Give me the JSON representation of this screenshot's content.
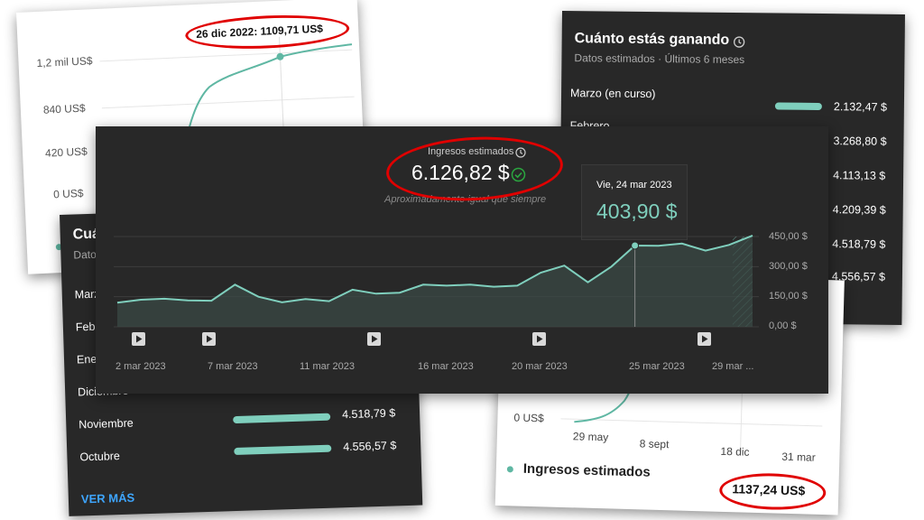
{
  "colors": {
    "accent": "#7fcfbd",
    "dark_bg": "#282828",
    "annotation": "#e00000"
  },
  "card_tl": {
    "y_ticks": [
      "1,2 mil US$",
      "840 US$",
      "420 US$",
      "0 US$"
    ],
    "callout": "26 dic 2022: 1109,71 US$"
  },
  "card_tr": {
    "title": "Cuánto estás ganando",
    "subtitle": "Datos estimados · Últimos 6 meses",
    "rows": [
      {
        "label": "Marzo (en curso)",
        "value": "2.132,47 $",
        "fraction": 0.47
      },
      {
        "label": "Febrero",
        "value": "3.268,80 $",
        "fraction": 0.72
      },
      {
        "label": "",
        "value": "4.113,13 $",
        "fraction": 0.9
      },
      {
        "label": "",
        "value": "4.209,39 $",
        "fraction": 0.92
      },
      {
        "label": "",
        "value": "4.518,79 $",
        "fraction": 0.99
      },
      {
        "label": "",
        "value": "4.556,57 $",
        "fraction": 1.0
      }
    ],
    "icon": "clock-icon"
  },
  "card_bl": {
    "title_partial": "Cuá",
    "subtitle_partial": "Dato",
    "rows_partial": [
      "Marz",
      "Febr",
      "Ener",
      "Diciembre"
    ],
    "rows": [
      {
        "label": "Noviembre",
        "value": "4.518,79 $",
        "fraction": 0.99
      },
      {
        "label": "Octubre",
        "value": "4.556,57 $",
        "fraction": 1.0
      }
    ],
    "link": "VER MÁS"
  },
  "card_br": {
    "y_ticks": [
      "0 US$"
    ],
    "x_ticks": [
      "29 may",
      "8 sept",
      "18 dic",
      "31 mar"
    ],
    "legend": "Ingresos estimados",
    "total": "1137,24 US$"
  },
  "main": {
    "heading": "Ingresos estimados",
    "total": "6.126,82 $",
    "note": "Aproximadamente igual que siempre",
    "tooltip": {
      "date": "Vie, 24 mar 2023",
      "value": "403,90 $"
    },
    "y_ticks": [
      "450,00 $",
      "300,00 $",
      "150,00 $",
      "0,00 $"
    ],
    "x_ticks": [
      "2 mar 2023",
      "7 mar 2023",
      "11 mar 2023",
      "16 mar 2023",
      "20 mar 2023",
      "25 mar 2023",
      "29 mar ..."
    ]
  },
  "chart_data": {
    "type": "area",
    "x": [
      "1 mar",
      "2 mar",
      "3 mar",
      "4 mar",
      "5 mar",
      "6 mar",
      "7 mar",
      "8 mar",
      "9 mar",
      "10 mar",
      "11 mar",
      "12 mar",
      "13 mar",
      "14 mar",
      "15 mar",
      "16 mar",
      "17 mar",
      "18 mar",
      "19 mar",
      "20 mar",
      "21 mar",
      "22 mar",
      "23 mar",
      "24 mar",
      "25 mar",
      "26 mar",
      "27 mar",
      "28 mar"
    ],
    "values": [
      120,
      135,
      140,
      132,
      130,
      210,
      150,
      122,
      138,
      128,
      185,
      165,
      170,
      210,
      205,
      210,
      200,
      205,
      270,
      305,
      222,
      300,
      405,
      404,
      415,
      380,
      408,
      455
    ],
    "ylim": [
      0,
      450
    ],
    "y_ticks": [
      0,
      150,
      300,
      450
    ],
    "highlight_index": 22,
    "grid": true
  }
}
